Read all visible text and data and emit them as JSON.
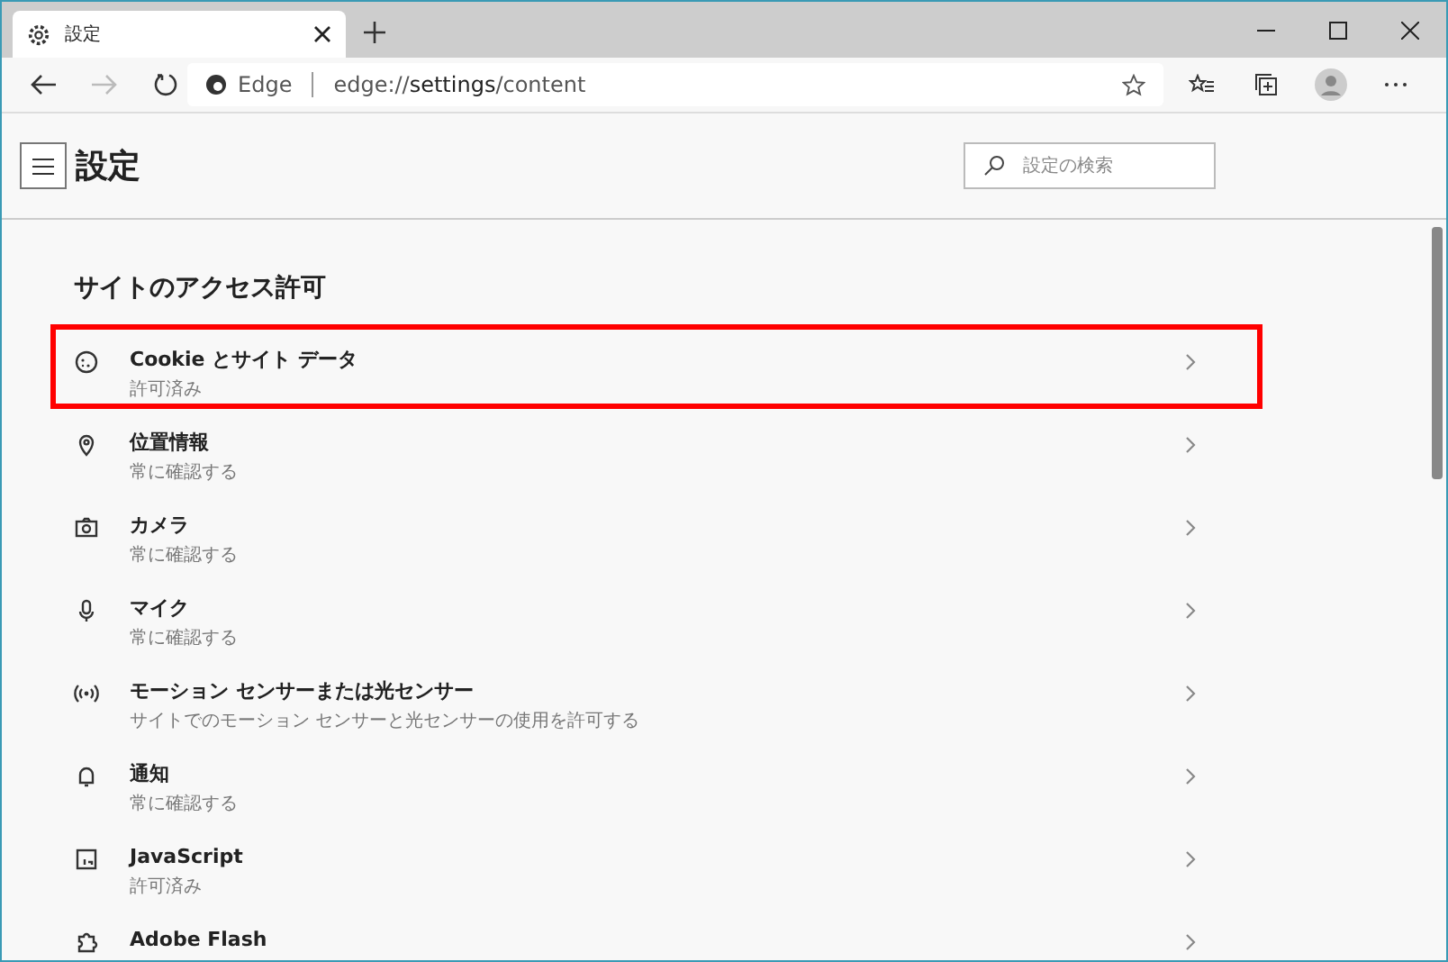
{
  "tab": {
    "title": "設定"
  },
  "address": {
    "site_label": "Edge",
    "url": "edge://**settings**/content",
    "favorite_on": false
  },
  "header": {
    "title": "設定",
    "search_placeholder": "設定の検索"
  },
  "section": {
    "heading": "サイトのアクセス許可",
    "items": [
      {
        "title": "Cookie とサイト データ",
        "subtitle": "許可済み",
        "highlighted": true
      },
      {
        "title": "位置情報",
        "subtitle": "常に確認する",
        "highlighted": false
      },
      {
        "title": "カメラ",
        "subtitle": "常に確認する",
        "highlighted": false
      },
      {
        "title": "マイク",
        "subtitle": "常に確認する",
        "highlighted": false
      },
      {
        "title": "モーション センサーまたは光センサー",
        "subtitle": "サイトでのモーション センサーと光センサーの使用を許可する",
        "highlighted": false
      },
      {
        "title": "通知",
        "subtitle": "常に確認する",
        "highlighted": false
      },
      {
        "title": "JavaScript",
        "subtitle": "許可済み",
        "highlighted": false
      },
      {
        "title": "Adobe Flash",
        "highlighted": false
      }
    ]
  }
}
